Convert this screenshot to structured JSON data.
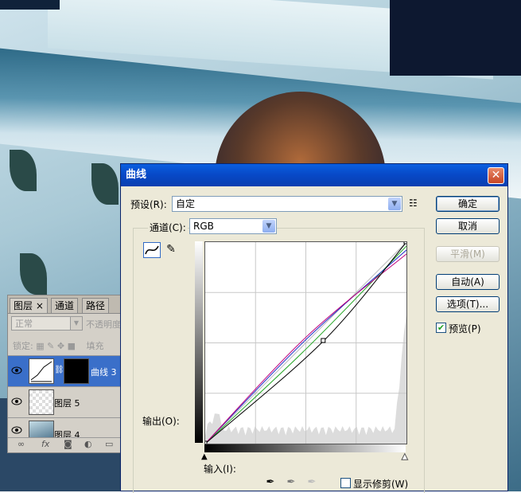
{
  "layers_panel": {
    "tabs": [
      "图层",
      "通道",
      "路径"
    ],
    "close_glyph": "×",
    "blend_mode": "正常",
    "opacity_label": "不透明度",
    "lock_label": "锁定:",
    "fill_label": "填充",
    "layers": [
      {
        "name": "曲线 3",
        "selected": true
      },
      {
        "name": "图层 5",
        "selected": false
      },
      {
        "name": "图层 4",
        "selected": false
      }
    ],
    "fx_label": "fx"
  },
  "dialog": {
    "title": "曲线",
    "close_glyph": "✕",
    "preset_label": "预设(R):",
    "preset_value": "自定",
    "channel_label": "通道(C):",
    "channel_value": "RGB",
    "output_label": "输出(O):",
    "input_label": "输入(I):",
    "show_clipping_label": "显示修剪(W)",
    "preview_label": "预览(P)",
    "preview_checked": true,
    "buttons": {
      "ok": "确定",
      "cancel": "取消",
      "smooth": "平滑(M)",
      "auto": "自动(A)",
      "options": "选项(T)..."
    }
  },
  "curves": {
    "grid_divisions": 4,
    "rgb": [
      [
        0,
        0
      ],
      [
        150,
        130
      ],
      [
        255,
        255
      ]
    ],
    "red": [
      [
        0,
        0
      ],
      [
        128,
        135
      ],
      [
        255,
        240
      ]
    ],
    "green": [
      [
        0,
        0
      ],
      [
        128,
        120
      ],
      [
        255,
        250
      ]
    ],
    "blue": [
      [
        0,
        0
      ],
      [
        128,
        132
      ],
      [
        255,
        245
      ]
    ],
    "colors": {
      "rgb": "#000000",
      "red": "#c0007a",
      "green": "#2aa82a",
      "blue": "#2030c8"
    }
  }
}
